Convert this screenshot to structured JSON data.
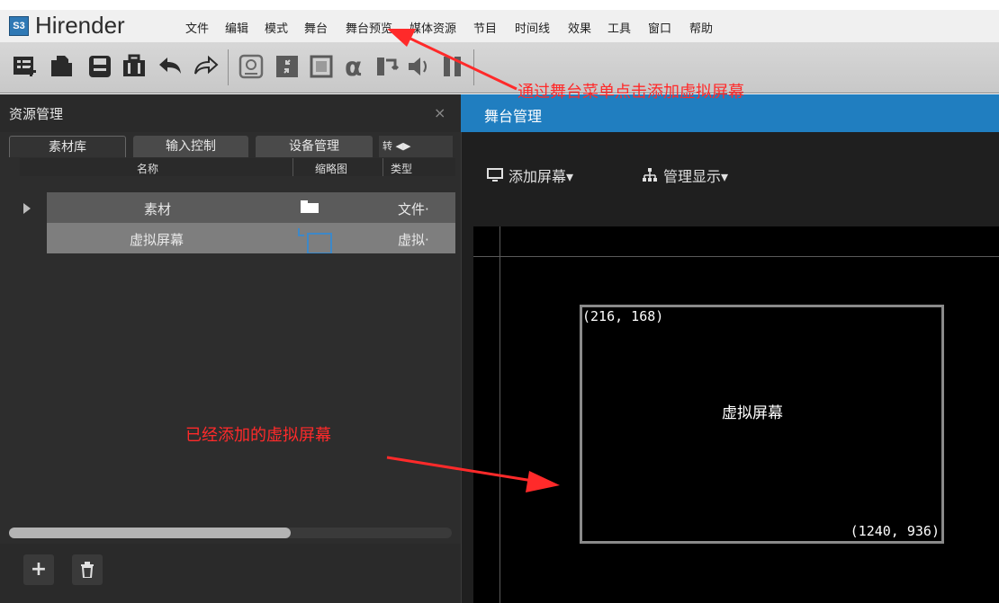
{
  "app": {
    "logo_text": "S3",
    "title": "Hirender"
  },
  "menu": {
    "items": [
      "文件",
      "编辑",
      "模式",
      "舞台",
      "舞台预览",
      "媒体资源",
      "节目",
      "时间线",
      "效果",
      "工具",
      "窗口",
      "帮助"
    ]
  },
  "toolbar": {
    "icons": [
      "add-list-icon",
      "open-folder-icon",
      "save-icon",
      "briefcase-icon",
      "undo-icon",
      "redo-icon",
      "location-icon",
      "shrink-icon",
      "frame-icon",
      "alpha-icon",
      "loop-icon",
      "volume-icon",
      "pause-icon"
    ]
  },
  "resource_panel": {
    "title": "资源管理",
    "close": "×",
    "tabs": [
      "素材库",
      "输入控制",
      "设备管理",
      "转"
    ],
    "columns": {
      "name": "名称",
      "thumb": "缩略图",
      "type": "类型"
    },
    "rows": [
      {
        "name": "素材",
        "type": "文件·"
      },
      {
        "name": "虚拟屏幕",
        "type": "虚拟·"
      }
    ],
    "buttons": {
      "add": "+",
      "delete": "🗑"
    }
  },
  "stage": {
    "title": "舞台管理",
    "add_screen": "添加屏幕▾",
    "manage_display": "管理显示▾",
    "virtual_screen": {
      "label": "虚拟屏幕",
      "top_left": "(216, 168)",
      "bottom_right": "(1240, 936)"
    }
  },
  "annotations": {
    "menu_hint": "通过舞台菜单点击添加虚拟屏幕",
    "screen_hint": "已经添加的虚拟屏幕"
  },
  "colors": {
    "stage_header": "#207ec0",
    "annotation": "#ff2a2a",
    "logo": "#2f79b5"
  }
}
